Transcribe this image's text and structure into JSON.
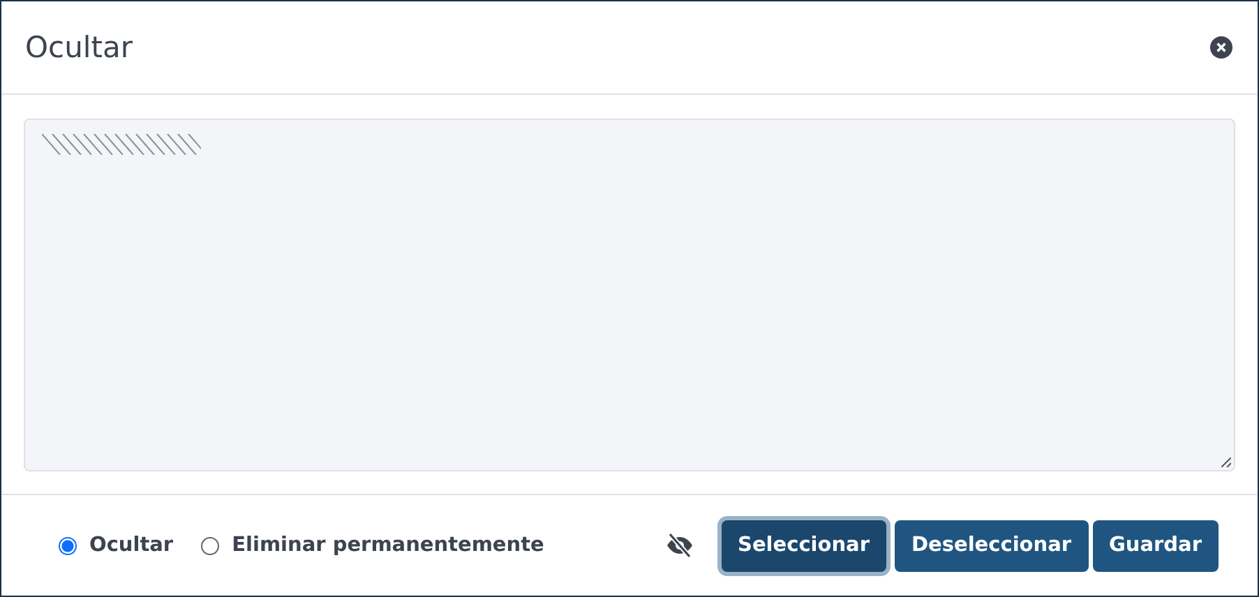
{
  "window": {
    "title": "Ocultar"
  },
  "options": [
    {
      "label": "Ocultar",
      "selected": true
    },
    {
      "label": "Eliminar permanentemente",
      "selected": false
    }
  ],
  "buttons": [
    {
      "label": "Seleccionar",
      "focused": true
    },
    {
      "label": "Deseleccionar",
      "focused": false
    },
    {
      "label": "Guardar",
      "focused": false
    }
  ]
}
